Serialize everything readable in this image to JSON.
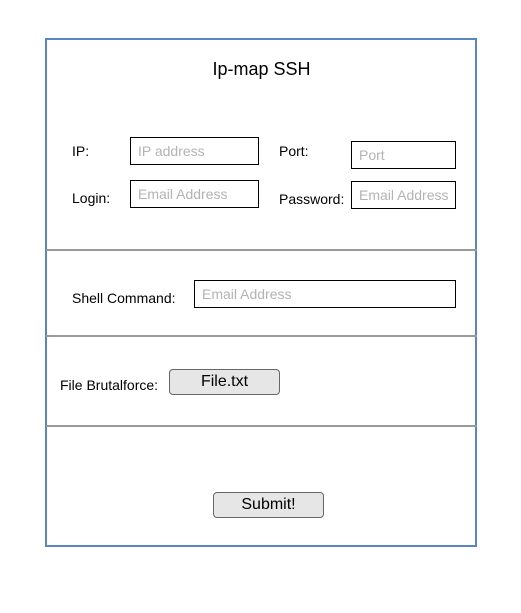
{
  "form": {
    "title": "Ip-map SSH",
    "ip": {
      "label": "IP:",
      "placeholder": "IP address"
    },
    "port": {
      "label": "Port:",
      "placeholder": "Port"
    },
    "login": {
      "label": "Login:",
      "placeholder": "Email Address"
    },
    "password": {
      "label": "Password:",
      "placeholder": "Email Address"
    },
    "shell": {
      "label": "Shell Command:",
      "placeholder": "Email Address"
    },
    "brute": {
      "label": "File Brutalforce:",
      "button_label": "File.txt"
    },
    "submit": {
      "label": "Submit!"
    }
  },
  "colors": {
    "frame_border": "#5b84c4",
    "divider": "#9a9a9a",
    "placeholder": "#b3b3b3",
    "button_fill": "#e6e6e6"
  }
}
